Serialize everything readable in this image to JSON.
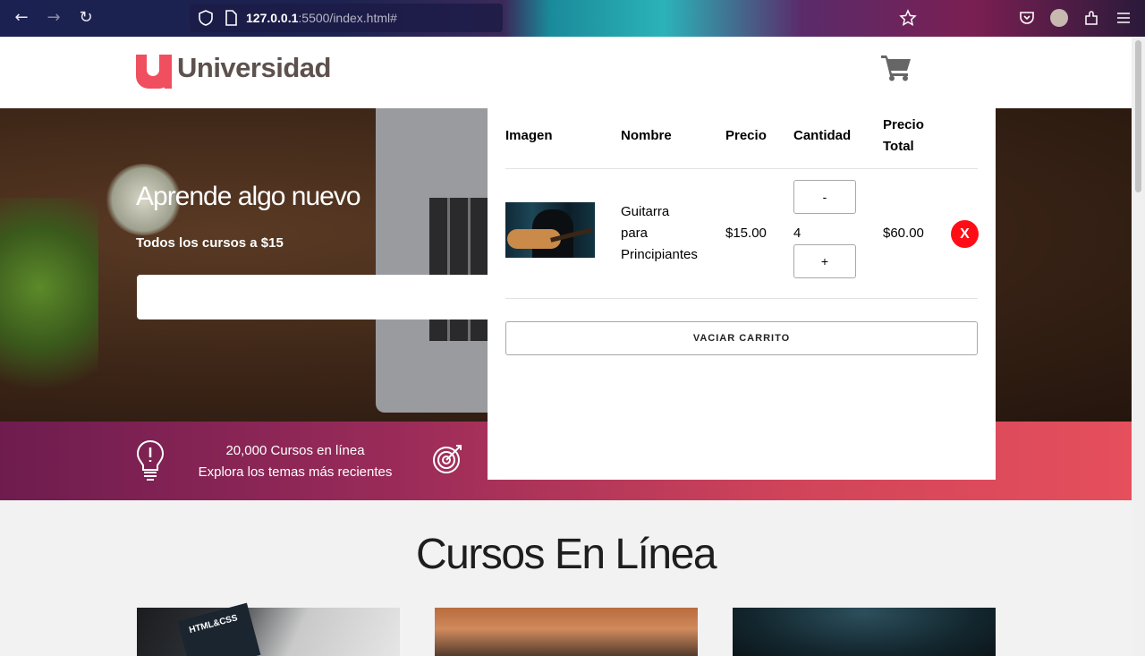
{
  "browser": {
    "url_host": "127.0.0.1",
    "url_rest": ":5500/index.html#"
  },
  "header": {
    "logo_letter": "u",
    "logo_text": "Universidad"
  },
  "hero": {
    "title": "Aprende algo nuevo",
    "subtitle": "Todos los cursos a $15",
    "search_placeholder": ""
  },
  "banner": {
    "line1": "20,000 Cursos en línea",
    "line2": "Explora los temas más recientes"
  },
  "courses": {
    "title": "Cursos En Línea",
    "card1_book": "HTML&CSS"
  },
  "cart": {
    "headers": {
      "image": "Imagen",
      "name": "Nombre",
      "price": "Precio",
      "quantity": "Cantidad",
      "total_line1": "Precio",
      "total_line2": "Total"
    },
    "items": [
      {
        "name_lines": [
          "Guitarra",
          "para",
          "Principiantes"
        ],
        "price": "$15.00",
        "quantity": "4",
        "total": "$60.00",
        "decrease_label": "-",
        "increase_label": "+",
        "remove_label": "X"
      }
    ],
    "empty_label": "VACIAR CARRITO"
  },
  "colors": {
    "brand": "#ef4f5f",
    "remove": "#ff0d16",
    "banner_start": "#6e1c4f",
    "banner_end": "#e64f5c"
  },
  "icons": [
    "back-icon",
    "forward-icon",
    "reload-icon",
    "shield-icon",
    "page-icon",
    "bookmark-star-icon",
    "pocket-icon",
    "profile-avatar-icon",
    "extensions-icon",
    "menu-icon",
    "cart-icon",
    "lightbulb-icon",
    "target-icon"
  ]
}
